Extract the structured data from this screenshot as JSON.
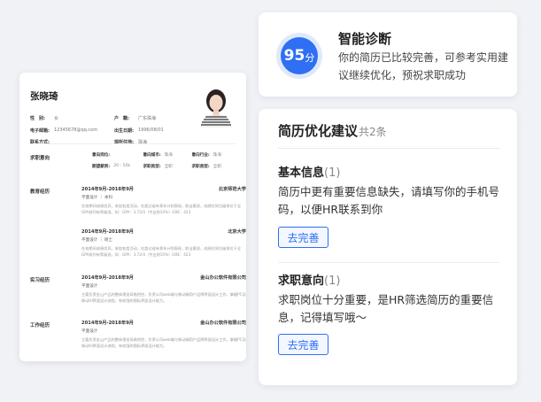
{
  "resume": {
    "name": "张晓琦",
    "info": [
      [
        {
          "k": "性　别:",
          "v": "女"
        },
        {
          "k": "户　籍:",
          "v": "广东珠海"
        }
      ],
      [
        {
          "k": "电子邮箱:",
          "v": "12345678@qq.com"
        },
        {
          "k": "出生日期:",
          "v": "1996/08/01"
        }
      ],
      [
        {
          "k": "联系方式:",
          "v": ""
        },
        {
          "k": "现所住地:",
          "v": "珠海"
        }
      ]
    ],
    "intent_title": "求职意向",
    "intent": [
      [
        {
          "k": "意向岗位:",
          "v": ""
        },
        {
          "k": "意向城市:",
          "v": "珠海"
        },
        {
          "k": "意向行业:",
          "v": "珠海"
        }
      ],
      [
        {
          "k": "期望薪资:",
          "v": "20 - 50k"
        },
        {
          "k": "求职类型:",
          "v": "全职"
        },
        {
          "k": "求职类型:",
          "v": "全职"
        }
      ]
    ],
    "education_title": "教育经历",
    "education": [
      {
        "date": "2014年9月-2018年9月",
        "org": "北京师范大学",
        "sub": "平面设计 ｜ 本科",
        "desc": "在校期间成绩优异，参加各类活动，在超过省有青年计划表现，取业素质，成绩在同位级排位于全GPA前列有等级进。如：GPA：3.72/4（专业前10%）GRE：423"
      },
      {
        "date": "2014年9月-2018年9月",
        "org": "北京大学",
        "sub": "平面设计 ｜ 硕士",
        "desc": "在校期间成绩优异，参加各类活动，在超过省有青年计划表现，取业素质，成绩在同位级排位于全GPA前列有等级进。如：GPA：3.72/4（专业前10%）GRE：423"
      }
    ],
    "internship_title": "实习经历",
    "internship": [
      {
        "date": "2014年9月-2018年9月",
        "org": "金山办公软件有限公司",
        "sub": "平面设计",
        "desc": "主要负责金山产品的整体视觉风格把控，负责公司web端与移动端用户品牌界面设计工作，掌握PC及移动UI界面设计流程，有较强的图标界面设计能力。"
      }
    ],
    "work_title": "工作经历",
    "work": [
      {
        "date": "2014年9月-2018年9月",
        "org": "金山办公软件有限公司",
        "sub": "平面设计",
        "desc": "主要负责金山产品的整体视觉风格把控，负责公司web端与移动端用户品牌界面设计工作，掌握PC及移动UI界面设计流程，有较强的图标界面设计能力。"
      }
    ]
  },
  "diagnosis": {
    "score": "95",
    "unit": "分",
    "title": "智能诊断",
    "text": "你的简历已比较完善，可参考实用建议继续优化，预祝求职成功"
  },
  "suggestions": {
    "title": "简历优化建议",
    "count": "共2条",
    "items": [
      {
        "title": "基本信息",
        "num": "(1)",
        "text": "简历中更有重要信息缺失，请填写你的手机号码，以便HR联系到你",
        "button": "去完善"
      },
      {
        "title": "求职意向",
        "num": "(1)",
        "text": "求职岗位十分重要，是HR筛选简历的重要信息，记得填写哦～",
        "button": "去完善"
      }
    ]
  },
  "colors": {
    "accent": "#2f6ff3",
    "ring": "#dfe9fb"
  }
}
